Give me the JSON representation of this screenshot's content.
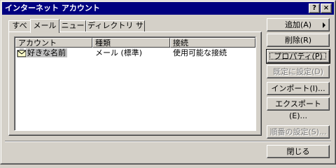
{
  "window": {
    "title": "インターネット アカウント",
    "help_glyph": "?",
    "close_glyph": "×"
  },
  "tabs": [
    {
      "label": "すべて",
      "active": false
    },
    {
      "label": "メール",
      "active": true
    },
    {
      "label": "ニュース",
      "active": false
    },
    {
      "label": "ディレクトリ サービス",
      "active": false
    }
  ],
  "list": {
    "columns": [
      "アカウント",
      "種類",
      "接続"
    ],
    "rows": [
      {
        "account": "好きな名前",
        "type": "メール (標準)",
        "connection": "使用可能な接続",
        "icon": "mail-account-icon"
      }
    ]
  },
  "buttons": {
    "add": "追加(A)",
    "remove": "削除(R)",
    "properties": "プロパティ(P)",
    "set_default": "既定に設定(D)",
    "import": "インポート(I)...",
    "export": "エクスポート(E)...",
    "set_order": "順番の設定(S)...",
    "close": "閉じる"
  },
  "colors": {
    "titlebar": "#000080",
    "face": "#d4d0c8",
    "selection": "#c0c0c0"
  }
}
